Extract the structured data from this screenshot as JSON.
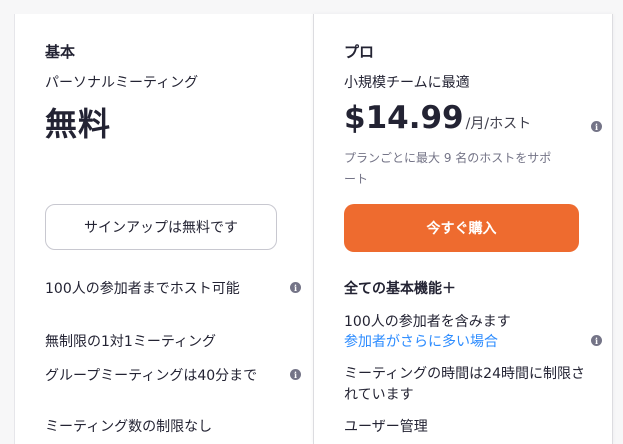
{
  "basic": {
    "plan_name": "基本",
    "subtitle": "パーソナルミーティング",
    "price": "無料",
    "button_label": "サインアップは無料です",
    "features": [
      "100人の参加者までホスト可能",
      "無制限の1対1ミーティング",
      "グループミーティングは40分まで",
      "ミーティング数の制限なし"
    ]
  },
  "pro": {
    "plan_name": "プロ",
    "subtitle": "小規模チームに最適",
    "price": "$14.99",
    "price_unit": "/月/ホスト",
    "price_note": "プランごとに最大 9 名のホストをサポート",
    "button_label": "今すぐ購入",
    "features_heading": "全ての基本機能＋",
    "participants_text": "100人の参加者を含みます",
    "participants_link": "参加者がさらに多い場合",
    "duration_text": "ミーティングの時間は24時間に制限されています",
    "clipped_feature": "ユーザー管理"
  },
  "icons": {
    "info": "info-icon"
  },
  "colors": {
    "accent": "#ee6b2f",
    "link": "#2d8cff",
    "text": "#232333",
    "muted": "#747487"
  }
}
